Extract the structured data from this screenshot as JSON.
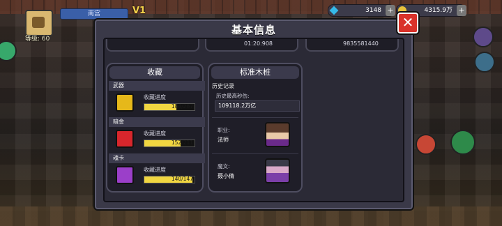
{
  "hud": {
    "player_name": "南宫",
    "level_label": "等级: 60",
    "vip": "V1",
    "gold": "3148",
    "coins": "4315.9万"
  },
  "dialog": {
    "title": "基本信息",
    "close_label": "✕",
    "top_cards": [
      "",
      "01:20:908",
      "9835581440"
    ]
  },
  "collection": {
    "title": "收藏",
    "categories": [
      {
        "name": "武器",
        "progress_label": "收藏进度",
        "current": 184,
        "total": 287,
        "text": "184/287",
        "color": "#e6b81a"
      },
      {
        "name": "暗金",
        "progress_label": "收藏进度",
        "current": 152,
        "total": 211,
        "text": "152/211",
        "color": "#d8262c"
      },
      {
        "name": "魂卡",
        "progress_label": "收藏进度",
        "current": 140,
        "total": 147,
        "text": "140/147",
        "color": "#9b3fc9"
      }
    ]
  },
  "dummy": {
    "title": "标准木桩",
    "history_label": "历史记录",
    "max_dps_label": "历史最高秒伤:",
    "max_dps_value": "109118.2万亿",
    "rows": [
      {
        "title": "职业:",
        "value": "法师",
        "portrait": "mage-portrait-icon"
      },
      {
        "title": "魔文:",
        "value": "聂小倩",
        "portrait": "rune-portrait-icon"
      }
    ]
  },
  "colors": {
    "accent_yellow": "#f1d641",
    "close_red": "#d9322a",
    "panel_bg": "#1f1e28"
  }
}
